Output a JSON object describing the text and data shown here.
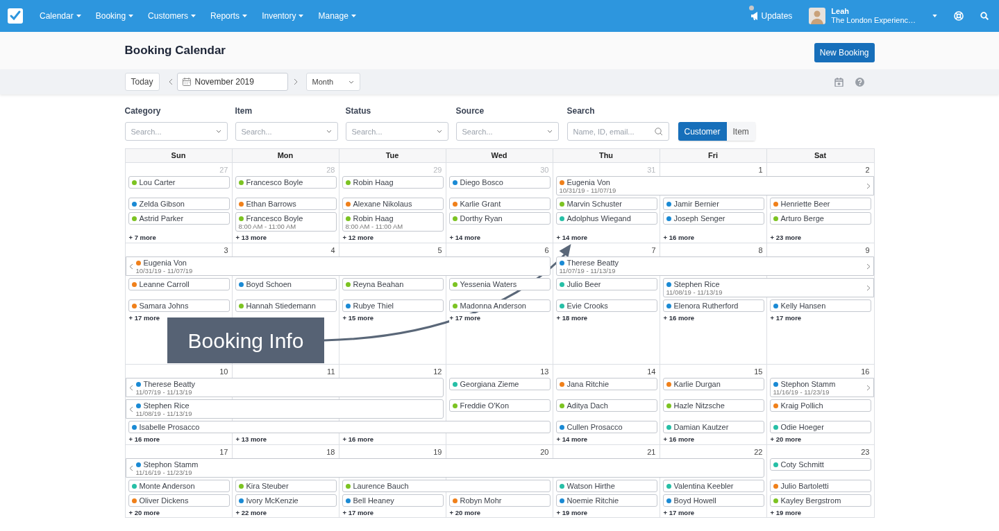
{
  "navbar": {
    "menus": [
      "Calendar",
      "Booking",
      "Customers",
      "Reports",
      "Inventory",
      "Manage"
    ],
    "updates": {
      "label": "Updates",
      "unread": true
    },
    "user": {
      "name": "Leah",
      "organization": "The London Experienc…"
    }
  },
  "page": {
    "title": "Booking Calendar",
    "primary_button": "New Booking"
  },
  "toolbar": {
    "today": "Today",
    "date": "November 2019",
    "view": "Month"
  },
  "filters": [
    {
      "label": "Category",
      "placeholder": "Search..."
    },
    {
      "label": "Item",
      "placeholder": "Search..."
    },
    {
      "label": "Status",
      "placeholder": "Search..."
    },
    {
      "label": "Source",
      "placeholder": "Search..."
    }
  ],
  "search": {
    "label": "Search",
    "placeholder": "Name, ID, email..."
  },
  "search_mode": [
    {
      "label": "Customer",
      "selected": true
    },
    {
      "label": "Item",
      "selected": false
    }
  ],
  "calendar": {
    "weekdays": [
      "Sun",
      "Mon",
      "Tue",
      "Wed",
      "Thu",
      "Fri",
      "Sat"
    ],
    "weeks": [
      {
        "days": [
          {
            "label": "27",
            "other_month": true,
            "more": "+ 7 more"
          },
          {
            "label": "28",
            "other_month": true,
            "more": "+ 13 more"
          },
          {
            "label": "29",
            "other_month": true,
            "more": "+ 12 more"
          },
          {
            "label": "30",
            "other_month": true,
            "more": "+ 14 more"
          },
          {
            "label": "31",
            "other_month": true,
            "more": "+ 14 more"
          },
          {
            "label": "1",
            "other_month": false,
            "more": "+ 16 more"
          },
          {
            "label": "2",
            "other_month": false,
            "more": "+ 23 more"
          }
        ],
        "lanes": [
          [
            {
              "kind": "event",
              "name": "Lou Carter",
              "color": "#7cc322",
              "continues_left": false,
              "continues_right": false
            },
            {
              "kind": "event",
              "name": "Francesco Boyle",
              "color": "#7cc322",
              "continues_left": false,
              "continues_right": false
            },
            {
              "kind": "event",
              "name": "Robin Haag",
              "color": "#7cc322",
              "continues_left": false,
              "continues_right": false
            },
            {
              "kind": "event",
              "name": "Diego Bosco",
              "color": "#1a8ad4",
              "continues_left": false,
              "continues_right": false
            },
            {
              "kind": "event",
              "name": "Eugenia Von",
              "detail": "10/31/19 - 11/07/19",
              "color": "#f0801a",
              "continues_left": false,
              "continues_right": true
            },
            {
              "kind": "continued"
            },
            {
              "kind": "continued"
            }
          ],
          [
            {
              "kind": "event",
              "name": "Zelda Gibson",
              "color": "#1a8ad4",
              "continues_left": false,
              "continues_right": false
            },
            {
              "kind": "event",
              "name": "Ethan Barrows",
              "color": "#f0801a",
              "continues_left": false,
              "continues_right": false
            },
            {
              "kind": "event",
              "name": "Alexane Nikolaus",
              "color": "#f0801a",
              "continues_left": false,
              "continues_right": false
            },
            {
              "kind": "event",
              "name": "Karlie Grant",
              "color": "#f0801a",
              "continues_left": false,
              "continues_right": false
            },
            {
              "kind": "event",
              "name": "Marvin Schuster",
              "color": "#7cc322",
              "continues_left": false,
              "continues_right": false
            },
            {
              "kind": "event",
              "name": "Jamir Bernier",
              "color": "#1a8ad4",
              "continues_left": false,
              "continues_right": false
            },
            {
              "kind": "event",
              "name": "Henriette Beer",
              "color": "#f0801a",
              "continues_left": false,
              "continues_right": false
            }
          ],
          [
            {
              "kind": "event",
              "name": "Astrid Parker",
              "color": "#7cc322",
              "continues_left": false,
              "continues_right": false
            },
            {
              "kind": "event",
              "name": "Francesco Boyle",
              "detail": "8:00 AM - 11:00 AM",
              "color": "#7cc322",
              "continues_left": false,
              "continues_right": false
            },
            {
              "kind": "event",
              "name": "Robin Haag",
              "detail": "8:00 AM - 11:00 AM",
              "color": "#7cc322",
              "continues_left": false,
              "continues_right": false
            },
            {
              "kind": "event",
              "name": "Dorthy Ryan",
              "color": "#7cc322",
              "continues_left": false,
              "continues_right": false
            },
            {
              "kind": "event",
              "name": "Adolphus Wiegand",
              "color": "#26bfa6",
              "continues_left": false,
              "continues_right": false
            },
            {
              "kind": "event",
              "name": "Joseph Senger",
              "color": "#1a8ad4",
              "continues_left": false,
              "continues_right": false
            },
            {
              "kind": "event",
              "name": "Arturo Berge",
              "color": "#7cc322",
              "continues_left": false,
              "continues_right": false
            }
          ]
        ],
        "kind": "week"
      },
      {
        "days": [
          {
            "label": "3",
            "other_month": false,
            "more": "+ 17 more"
          },
          {
            "label": "4",
            "other_month": false
          },
          {
            "label": "5",
            "other_month": false,
            "more": "+ 15 more"
          },
          {
            "label": "6",
            "other_month": false,
            "more": "+ 17 more"
          },
          {
            "label": "7",
            "other_month": false,
            "more": "+ 18 more"
          },
          {
            "label": "8",
            "other_month": false,
            "more": "+ 16 more"
          },
          {
            "label": "9",
            "other_month": false,
            "more": "+ 17 more"
          }
        ],
        "lanes": [
          [
            {
              "kind": "event",
              "name": "Eugenia Von",
              "detail": "10/31/19 - 11/07/19",
              "color": "#f0801a",
              "continues_left": true,
              "continues_right": false
            },
            {
              "kind": "continued"
            },
            {
              "kind": "continued"
            },
            {
              "kind": "continued"
            },
            {
              "kind": "event",
              "name": "Therese Beatty",
              "detail": "11/07/19 - 11/13/19",
              "color": "#1a8ad4",
              "continues_left": false,
              "continues_right": true
            },
            {
              "kind": "continued"
            },
            {
              "kind": "continued"
            }
          ],
          [
            {
              "kind": "event",
              "name": "Leanne Carroll",
              "color": "#f0801a",
              "continues_left": false,
              "continues_right": false
            },
            {
              "kind": "event",
              "name": "Boyd Schoen",
              "color": "#1a8ad4",
              "continues_left": false,
              "continues_right": false
            },
            {
              "kind": "event",
              "name": "Reyna Beahan",
              "color": "#7cc322",
              "continues_left": false,
              "continues_right": false
            },
            {
              "kind": "event",
              "name": "Yessenia Waters",
              "color": "#7cc322",
              "continues_left": false,
              "continues_right": false
            },
            {
              "kind": "event",
              "name": "Julio Beer",
              "color": "#26bfa6",
              "continues_left": false,
              "continues_right": false
            },
            {
              "kind": "event",
              "name": "Stephen Rice",
              "detail": "11/08/19 - 11/13/19",
              "color": "#1a8ad4",
              "continues_left": false,
              "continues_right": true
            },
            {
              "kind": "continued"
            }
          ],
          [
            {
              "kind": "event",
              "name": "Samara Johns",
              "color": "#f0801a",
              "continues_left": false,
              "continues_right": false
            },
            {
              "kind": "event",
              "name": "Hannah Stiedemann",
              "color": "#7cc322",
              "continues_left": false,
              "continues_right": false
            },
            {
              "kind": "event",
              "name": "Rubye Thiel",
              "color": "#1a8ad4",
              "continues_left": false,
              "continues_right": false
            },
            {
              "kind": "event",
              "name": "Madonna Anderson",
              "color": "#7cc322",
              "continues_left": false,
              "continues_right": false
            },
            {
              "kind": "event",
              "name": "Evie Crooks",
              "color": "#26bfa6",
              "continues_left": false,
              "continues_right": false
            },
            {
              "kind": "event",
              "name": "Elenora Rutherford",
              "color": "#1a8ad4",
              "continues_left": false,
              "continues_right": false
            },
            {
              "kind": "event",
              "name": "Kelly Hansen",
              "color": "#1a8ad4",
              "continues_left": false,
              "continues_right": false
            }
          ]
        ],
        "kind": "week"
      },
      {
        "days": [
          {
            "label": "10",
            "other_month": false,
            "more": "+ 16 more"
          },
          {
            "label": "11",
            "other_month": false,
            "more": "+ 13 more"
          },
          {
            "label": "12",
            "other_month": false,
            "more": "+ 16 more"
          },
          {
            "label": "13",
            "other_month": false
          },
          {
            "label": "14",
            "other_month": false,
            "more": "+ 14 more"
          },
          {
            "label": "15",
            "other_month": false,
            "more": "+ 16 more"
          },
          {
            "label": "16",
            "other_month": false,
            "more": "+ 20 more"
          }
        ],
        "lanes": [
          [
            {
              "kind": "event",
              "name": "Therese Beatty",
              "detail": "11/07/19 - 11/13/19",
              "color": "#1a8ad4",
              "continues_left": true,
              "continues_right": false
            },
            {
              "kind": "continued"
            },
            {
              "kind": "continued"
            },
            {
              "kind": "event",
              "name": "Georgiana Zieme",
              "color": "#26bfa6",
              "continues_left": false,
              "continues_right": false
            },
            {
              "kind": "event",
              "name": "Jana Ritchie",
              "color": "#f0801a",
              "continues_left": false,
              "continues_right": false
            },
            {
              "kind": "event",
              "name": "Karlie Durgan",
              "color": "#f0801a",
              "continues_left": false,
              "continues_right": false
            },
            {
              "kind": "event",
              "name": "Stephon Stamm",
              "detail": "11/16/19 - 11/23/19",
              "color": "#1a8ad4",
              "continues_left": false,
              "continues_right": true
            }
          ],
          [
            {
              "kind": "event",
              "name": "Stephen Rice",
              "detail": "11/08/19 - 11/13/19",
              "color": "#1a8ad4",
              "continues_left": true,
              "continues_right": false
            },
            {
              "kind": "continued"
            },
            {
              "kind": "continued"
            },
            {
              "kind": "event",
              "name": "Freddie O'Kon",
              "color": "#7cc322",
              "continues_left": false,
              "continues_right": false
            },
            {
              "kind": "event",
              "name": "Aditya Dach",
              "color": "#7cc322",
              "continues_left": false,
              "continues_right": false
            },
            {
              "kind": "event",
              "name": "Hazle Nitzsche",
              "color": "#7cc322",
              "continues_left": false,
              "continues_right": false
            },
            {
              "kind": "event",
              "name": "Kraig Pollich",
              "color": "#f0801a",
              "continues_left": false,
              "continues_right": false
            }
          ],
          [
            {
              "kind": "event",
              "name": "Isabelle Prosacco",
              "color": "#1a8ad4",
              "continues_left": false,
              "continues_right": false
            },
            {
              "kind": "continued"
            },
            {
              "kind": "continued"
            },
            {
              "kind": "continued"
            },
            {
              "kind": "event",
              "name": "Cullen Prosacco",
              "color": "#1a8ad4",
              "continues_left": false,
              "continues_right": false
            },
            {
              "kind": "event",
              "name": "Damian Kautzer",
              "color": "#26bfa6",
              "continues_left": false,
              "continues_right": false
            },
            {
              "kind": "event",
              "name": "Odie Hoeger",
              "color": "#26bfa6",
              "continues_left": false,
              "continues_right": false
            }
          ]
        ],
        "kind": "week"
      },
      {
        "days": [
          {
            "label": "17",
            "other_month": false,
            "more": "+ 20 more"
          },
          {
            "label": "18",
            "other_month": false,
            "more": "+ 22 more"
          },
          {
            "label": "19",
            "other_month": false,
            "more": "+ 17 more"
          },
          {
            "label": "20",
            "other_month": false,
            "more": "+ 20 more"
          },
          {
            "label": "21",
            "other_month": false,
            "more": "+ 19 more"
          },
          {
            "label": "22",
            "other_month": false,
            "more": "+ 17 more"
          },
          {
            "label": "23",
            "other_month": false,
            "more": "+ 19 more"
          }
        ],
        "lanes": [
          [
            {
              "kind": "event",
              "name": "Stephon Stamm",
              "detail": "11/16/19 - 11/23/19",
              "color": "#1a8ad4",
              "continues_left": true,
              "continues_right": false
            },
            {
              "kind": "continued"
            },
            {
              "kind": "continued"
            },
            {
              "kind": "continued"
            },
            {
              "kind": "continued"
            },
            {
              "kind": "continued"
            },
            {
              "kind": "event",
              "name": "Coty Schmitt",
              "color": "#26bfa6",
              "continues_left": false,
              "continues_right": false
            }
          ],
          [
            {
              "kind": "event",
              "name": "Monte Anderson",
              "color": "#26bfa6",
              "continues_left": false,
              "continues_right": false
            },
            {
              "kind": "event",
              "name": "Kira Steuber",
              "color": "#7cc322",
              "continues_left": false,
              "continues_right": false
            },
            {
              "kind": "event",
              "name": "Laurence Bauch",
              "color": "#7cc322",
              "continues_left": false,
              "continues_right": false
            },
            {
              "kind": "continued"
            },
            {
              "kind": "event",
              "name": "Watson Hirthe",
              "color": "#26bfa6",
              "continues_left": false,
              "continues_right": false
            },
            {
              "kind": "event",
              "name": "Valentina Keebler",
              "color": "#26bfa6",
              "continues_left": false,
              "continues_right": false
            },
            {
              "kind": "event",
              "name": "Julio Bartoletti",
              "color": "#f0801a",
              "continues_left": false,
              "continues_right": false
            }
          ],
          [
            {
              "kind": "event",
              "name": "Oliver Dickens",
              "color": "#f0801a",
              "continues_left": false,
              "continues_right": false
            },
            {
              "kind": "event",
              "name": "Ivory McKenzie",
              "color": "#1a8ad4",
              "continues_left": false,
              "continues_right": false
            },
            {
              "kind": "event",
              "name": "Bell Heaney",
              "color": "#1a8ad4",
              "continues_left": false,
              "continues_right": false
            },
            {
              "kind": "event",
              "name": "Robyn Mohr",
              "color": "#f0801a",
              "continues_left": false,
              "continues_right": false
            },
            {
              "kind": "event",
              "name": "Noemie Ritchie",
              "color": "#1a8ad4",
              "continues_left": false,
              "continues_right": false
            },
            {
              "kind": "event",
              "name": "Boyd Howell",
              "color": "#1a8ad4",
              "continues_left": false,
              "continues_right": false
            },
            {
              "kind": "event",
              "name": "Kayley Bergstrom",
              "color": "#7cc322",
              "continues_left": false,
              "continues_right": false
            }
          ]
        ],
        "kind": "week"
      }
    ]
  },
  "annotation": {
    "text": "Booking Info"
  }
}
